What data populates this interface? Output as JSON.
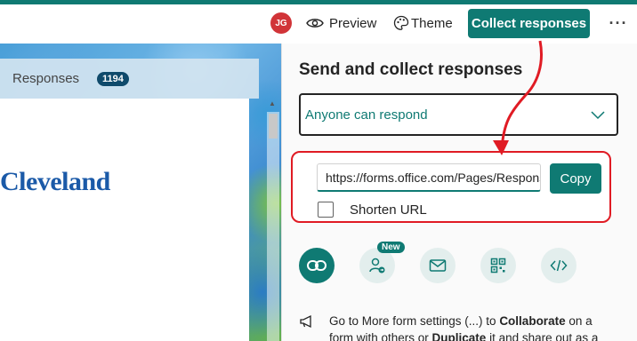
{
  "toolbar": {
    "avatar_initials": "JG",
    "preview_label": "Preview",
    "theme_label": "Theme",
    "collect_label": "Collect responses",
    "more_label": "···"
  },
  "form_preview": {
    "responses_label": "Responses",
    "responses_count": "1194",
    "header_text": "Cleveland"
  },
  "share_panel": {
    "title": "Send and collect responses",
    "audience_selected": "Anyone can respond",
    "url_value": "https://forms.office.com/Pages/ResponsePage.aspx",
    "copy_label": "Copy",
    "shorten_label": "Shorten URL",
    "shorten_checked": false,
    "new_badge": "New",
    "share_methods": [
      "link-icon",
      "collaborate-icon",
      "email-icon",
      "qr-code-icon",
      "embed-icon"
    ],
    "info_prefix": "Go to More form settings (...) to ",
    "info_bold1": "Collaborate",
    "info_mid": " on a form with others or ",
    "info_bold2": "Duplicate",
    "info_suffix": " it and share out as a"
  },
  "colors": {
    "accent": "#0f7a73",
    "annotation": "#e01b24",
    "avatar": "#d13438"
  }
}
